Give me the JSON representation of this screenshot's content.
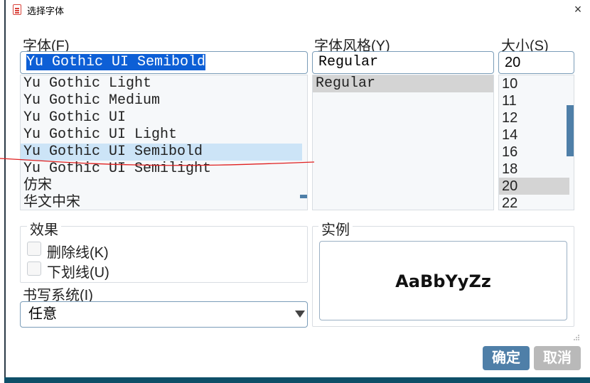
{
  "window": {
    "title": "选择字体",
    "close_glyph": "×",
    "icon": "document-red-icon"
  },
  "font": {
    "label": "字体(F)",
    "value": "Yu Gothic UI Semibold",
    "items": [
      "Yu Gothic Light",
      "Yu Gothic Medium",
      "Yu Gothic UI",
      "Yu Gothic UI Light",
      "Yu Gothic UI Semibold",
      "Yu Gothic UI Semilight",
      "仿宋",
      "华文中宋"
    ],
    "selected_index": 4
  },
  "style": {
    "label": "字体风格(Y)",
    "value": "Regular",
    "items": [
      "Regular"
    ],
    "selected_index": 0
  },
  "size": {
    "label": "大小(S)",
    "value": "20",
    "items": [
      "10",
      "11",
      "12",
      "14",
      "16",
      "18",
      "20",
      "22"
    ],
    "selected_index": 6
  },
  "effects": {
    "title": "效果",
    "strikeout_label": "删除线(K)",
    "underline_label": "下划线(U)",
    "strikeout_checked": false,
    "underline_checked": false
  },
  "writing_system": {
    "label": "书写系统(I)",
    "value": "任意"
  },
  "sample": {
    "title": "实例",
    "text": "AaBbYyZz"
  },
  "buttons": {
    "ok": "确定",
    "cancel": "取消"
  },
  "colors": {
    "accent": "#4f7fa8",
    "selection_light": "#cce4f7",
    "selection_gray": "#d4d4d4",
    "annotation_red": "#e02020",
    "cancel_gray": "#b9b9b9"
  }
}
